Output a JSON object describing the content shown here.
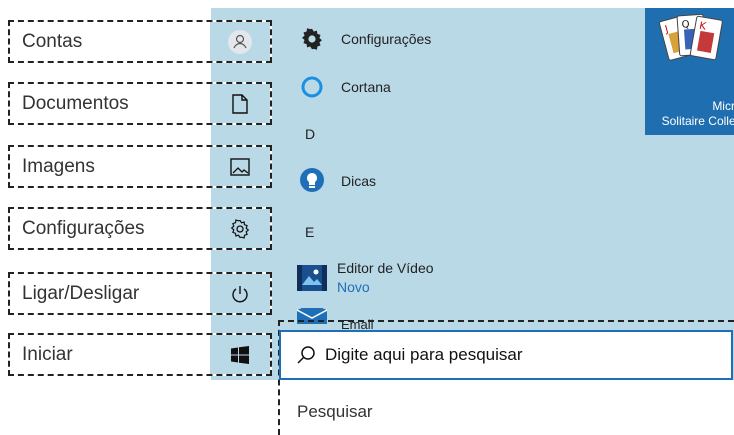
{
  "callouts": [
    {
      "label": "Contas",
      "icon": "user-icon"
    },
    {
      "label": "Documentos",
      "icon": "document-icon"
    },
    {
      "label": "Imagens",
      "icon": "image-icon"
    },
    {
      "label": "Configurações",
      "icon": "gear-icon"
    },
    {
      "label": "Ligar/Desligar",
      "icon": "power-icon"
    },
    {
      "label": "Iniciar",
      "icon": "windows-logo-icon"
    }
  ],
  "apps": {
    "configuracoes": "Configurações",
    "cortana": "Cortana",
    "letter_d": "D",
    "dicas": "Dicas",
    "letter_e": "E",
    "editor_video": "Editor de Vídeo",
    "editor_video_badge": "Novo",
    "email": "Email"
  },
  "tile": {
    "caption_line1": "Microsoft",
    "caption_line2": "Solitaire Collection"
  },
  "search": {
    "placeholder": "Digite aqui para pesquisar",
    "caption": "Pesquisar"
  },
  "colors": {
    "panel": "#b9d9e6",
    "accent": "#1e6fb8"
  }
}
